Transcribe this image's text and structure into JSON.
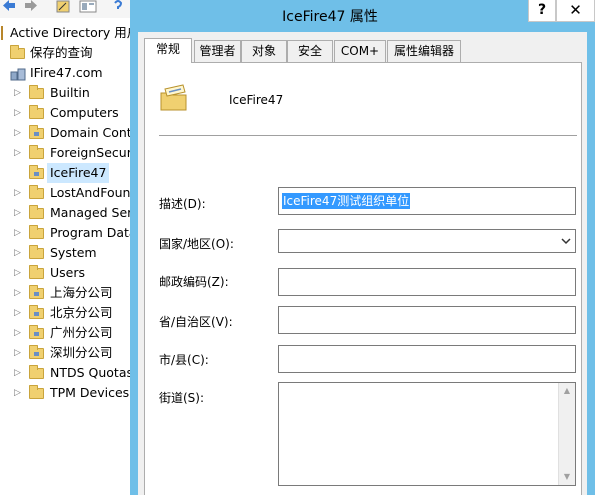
{
  "tree": {
    "root_label": "Active Directory 用户",
    "saved_queries": "保存的查询",
    "domain": "IFire47.com",
    "items": [
      {
        "label": "Builtin",
        "ou": false
      },
      {
        "label": "Computers",
        "ou": false
      },
      {
        "label": "Domain Contr",
        "ou": true
      },
      {
        "label": "ForeignSecuri",
        "ou": false
      },
      {
        "label": "IceFire47",
        "ou": true,
        "selected": true
      },
      {
        "label": "LostAndFound",
        "ou": false
      },
      {
        "label": "Managed Ser",
        "ou": false
      },
      {
        "label": "Program Data",
        "ou": false
      },
      {
        "label": "System",
        "ou": false
      },
      {
        "label": "Users",
        "ou": false
      },
      {
        "label": "上海分公司",
        "ou": true
      },
      {
        "label": "北京分公司",
        "ou": true
      },
      {
        "label": "广州分公司",
        "ou": true
      },
      {
        "label": "深圳分公司",
        "ou": true
      },
      {
        "label": "NTDS Quotas",
        "ou": false
      },
      {
        "label": "TPM Devices",
        "ou": false
      }
    ]
  },
  "dialog": {
    "title": "IceFire47 属性",
    "help_label": "?",
    "close_label": "✕",
    "tabs": [
      "常规",
      "管理者",
      "对象",
      "安全",
      "COM+",
      "属性编辑器"
    ],
    "active_tab": "常规",
    "general": {
      "ou_name": "IceFire47",
      "description_label": "描述(D):",
      "description_value": "IceFire47测试组织单位",
      "country_label": "国家/地区(O):",
      "country_value": "",
      "postal_label": "邮政编码(Z):",
      "postal_value": "",
      "state_label": "省/自治区(V):",
      "state_value": "",
      "city_label": "市/县(C):",
      "city_value": "",
      "street_label": "街道(S):",
      "street_value": ""
    }
  },
  "colors": {
    "titlebar": "#6fbfe8",
    "selection": "#3399ff",
    "tree_selection": "#cce8ff"
  }
}
